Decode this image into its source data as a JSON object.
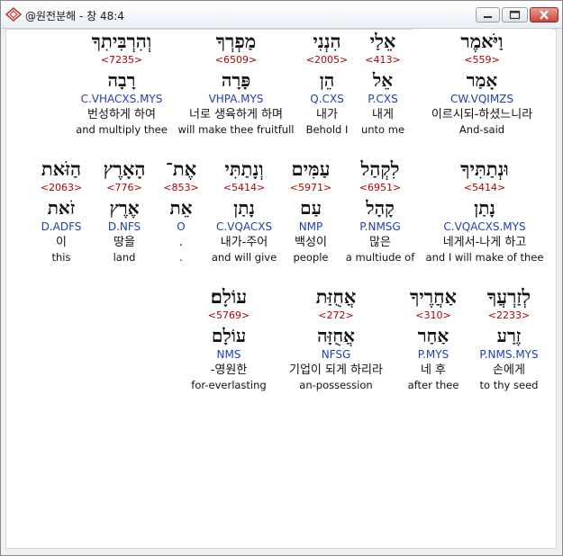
{
  "window": {
    "title": "@원전분해 - 창 48:4"
  },
  "icons": {
    "app": "app-logo-icon",
    "minimize": "minimize-icon",
    "maximize": "maximize-icon",
    "close": "close-icon"
  },
  "rows": [
    {
      "words": [
        {
          "hebrew": "וַיֹּאמֶר",
          "strong": "<559>",
          "lemma": "אָמַר",
          "parse": "CW.VQIMZS",
          "korean": "이르시되-하셨느니라",
          "english": "And-said"
        },
        {
          "hebrew": "אֵלַי",
          "strong": "<413>",
          "lemma": "אֵל",
          "parse": "P.CXS",
          "korean": "내게",
          "english": "unto me"
        },
        {
          "hebrew": "הִנְנִי",
          "strong": "<2005>",
          "lemma": "הֵן",
          "parse": "Q.CXS",
          "korean": "내가",
          "english": "Behold I"
        },
        {
          "hebrew": "מַפְרְךָ",
          "strong": "<6509>",
          "lemma": "פָּרָה",
          "parse": "VHPA.MYS",
          "korean": "너로 생육하게 하며",
          "english": "will make thee fruitfull"
        },
        {
          "hebrew": "וְהִרְבִּיתִךָ",
          "strong": "<7235>",
          "lemma": "רָבָה",
          "parse": "C.VHACXS.MYS",
          "korean": "번성하게 하여",
          "english": "and multiply thee"
        }
      ]
    },
    {
      "words": [
        {
          "hebrew": "וּנְתַתִּיךָ",
          "strong": "<5414>",
          "lemma": "נָתַן",
          "parse": "C.VQACXS.MYS",
          "korean": "네게서-나게 하고",
          "english": "and I will make of thee"
        },
        {
          "hebrew": "לִקְהַל",
          "strong": "<6951>",
          "lemma": "קָהָל",
          "parse": "P.NMSG",
          "korean": "많은",
          "english": "a multiude of"
        },
        {
          "hebrew": "עַמִּים",
          "strong": "<5971>",
          "lemma": "עַם",
          "parse": "NMP",
          "korean": "백성이",
          "english": "people"
        },
        {
          "hebrew": "וְנָתַתִּי",
          "strong": "<5414>",
          "lemma": "נָתַן",
          "parse": "C.VQACXS",
          "korean": "내가-주어",
          "english": "and will give"
        },
        {
          "hebrew": "אֶת־",
          "strong": "<853>",
          "lemma": "אֵת",
          "parse": "O",
          "korean": ".",
          "english": "."
        },
        {
          "hebrew": "הָאָרֶץ",
          "strong": "<776>",
          "lemma": "אֶרֶץ",
          "parse": "D.NFS",
          "korean": "땅을",
          "english": "land"
        },
        {
          "hebrew": "הַזֹּאת",
          "strong": "<2063>",
          "lemma": "זֹאת",
          "parse": "D.ADFS",
          "korean": "이",
          "english": "this"
        }
      ]
    },
    {
      "words": [
        {
          "hebrew": "לְזַרְעֲךָ",
          "strong": "<2233>",
          "lemma": "זֶרַע",
          "parse": "P.NMS.MYS",
          "korean": "손에게",
          "english": "to thy seed"
        },
        {
          "hebrew": "אַחֲרֶיךָ",
          "strong": "<310>",
          "lemma": "אַחַר",
          "parse": "P.MYS",
          "korean": "네 후",
          "english": "after thee"
        },
        {
          "hebrew": "אֲחֻזַּת",
          "strong": "<272>",
          "lemma": "אֲחֻזָּה",
          "parse": "NFSG",
          "korean": "기업이 되게 하리라",
          "english": "an-possession"
        },
        {
          "hebrew": "עוֹלָם׃",
          "strong": "<5769>",
          "lemma": "עוֹלָם",
          "parse": "NMS",
          "korean": "-영원한",
          "english": "for-everlasting"
        }
      ]
    }
  ]
}
